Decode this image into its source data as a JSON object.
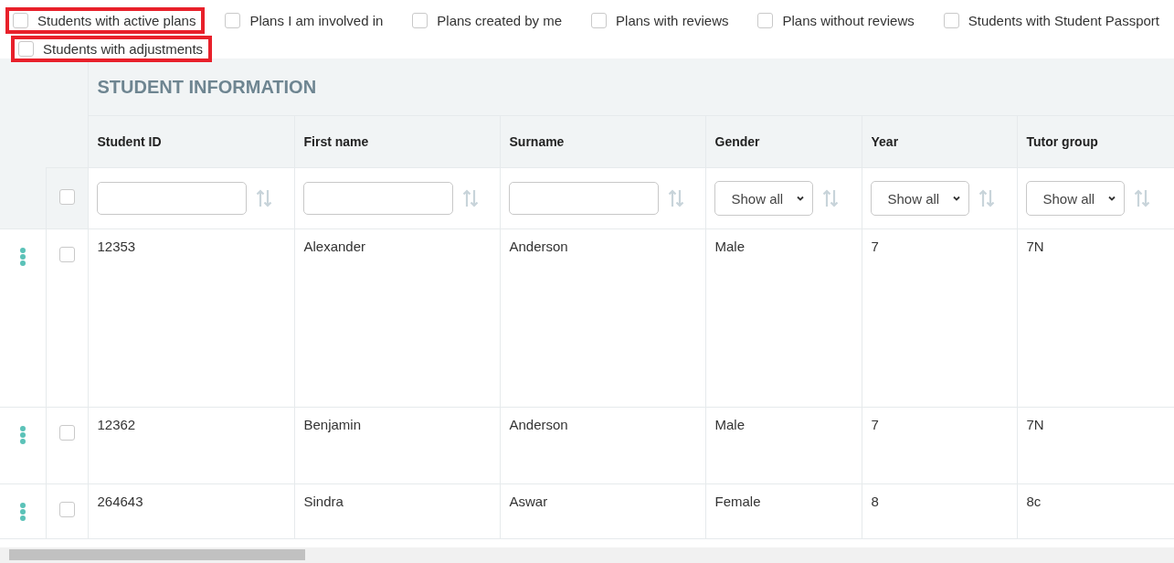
{
  "filters": [
    {
      "label": "Students with active plans",
      "checked": false,
      "highlighted": true
    },
    {
      "label": "Plans I am involved in",
      "checked": false,
      "highlighted": false
    },
    {
      "label": "Plans created by me",
      "checked": false,
      "highlighted": false
    },
    {
      "label": "Plans with reviews",
      "checked": false,
      "highlighted": false
    },
    {
      "label": "Plans without reviews",
      "checked": false,
      "highlighted": false
    },
    {
      "label": "Students with Student Passport",
      "checked": false,
      "highlighted": false
    },
    {
      "label": "Students with adjustments",
      "checked": false,
      "highlighted": true
    }
  ],
  "table": {
    "group_title": "STUDENT INFORMATION",
    "select_all_checked": false,
    "columns": [
      {
        "label": "Student ID",
        "kind": "text"
      },
      {
        "label": "First name",
        "kind": "text"
      },
      {
        "label": "Surname",
        "kind": "text"
      },
      {
        "label": "Gender",
        "kind": "select",
        "value": "Show all"
      },
      {
        "label": "Year",
        "kind": "select",
        "value": "Show all"
      },
      {
        "label": "Tutor group",
        "kind": "select",
        "value": "Show all"
      }
    ],
    "rows": [
      {
        "cells": [
          "12353",
          "Alexander",
          "Anderson",
          "Male",
          "7",
          "7N"
        ],
        "checked": false
      },
      {
        "cells": [
          "12362",
          "Benjamin",
          "Anderson",
          "Male",
          "7",
          "7N"
        ],
        "checked": false
      },
      {
        "cells": [
          "264643",
          "Sindra",
          "Aswar",
          "Female",
          "8",
          "8c"
        ],
        "checked": false
      }
    ]
  }
}
